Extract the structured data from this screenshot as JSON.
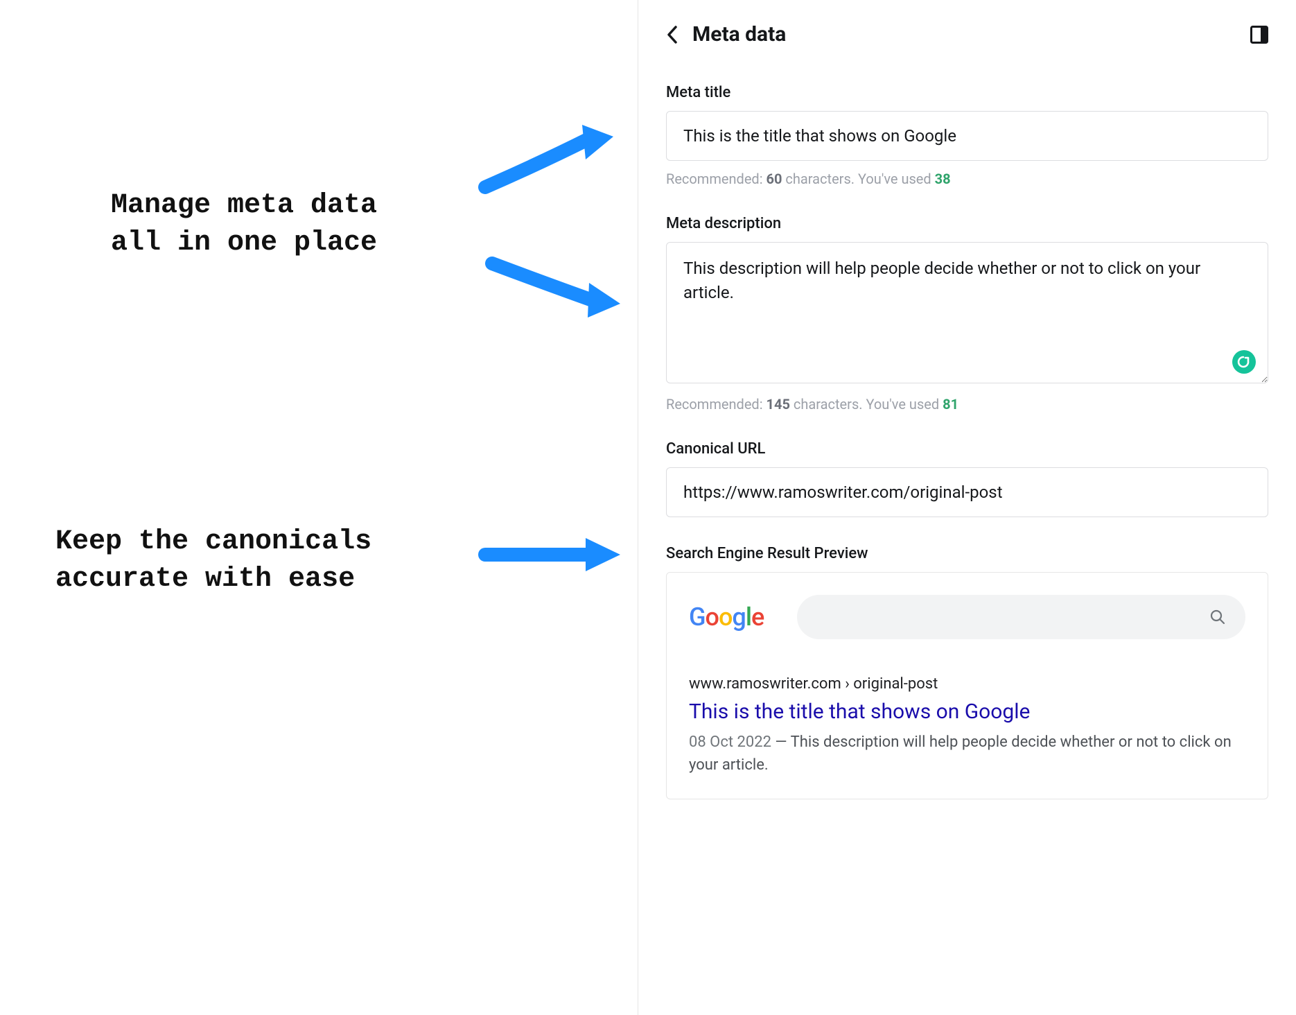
{
  "callouts": {
    "meta": "Manage meta data\nall in one place",
    "canonical": "Keep the canonicals\naccurate with ease"
  },
  "panel": {
    "title": "Meta data"
  },
  "meta_title": {
    "label": "Meta title",
    "value": "This is the title that shows on Google",
    "hint_prefix": "Recommended: ",
    "recommended": "60",
    "hint_mid": " characters. You've used ",
    "used": "38"
  },
  "meta_description": {
    "label": "Meta description",
    "value": "This description will help people decide whether or not to click on your article.",
    "hint_prefix": "Recommended: ",
    "recommended": "145",
    "hint_mid": " characters. You've used ",
    "used": "81"
  },
  "canonical": {
    "label": "Canonical URL",
    "value": "https://www.ramoswriter.com/original-post"
  },
  "serp": {
    "label": "Search Engine Result Preview",
    "breadcrumb": "www.ramoswriter.com › original-post",
    "title": "This is the title that shows on Google",
    "date": "08 Oct 2022",
    "separator": " — ",
    "description": "This description will help people decide whether or not to click on your article."
  },
  "google_letters": {
    "g1": "G",
    "g2": "o",
    "g3": "o",
    "g4": "g",
    "g5": "l",
    "g6": "e"
  }
}
